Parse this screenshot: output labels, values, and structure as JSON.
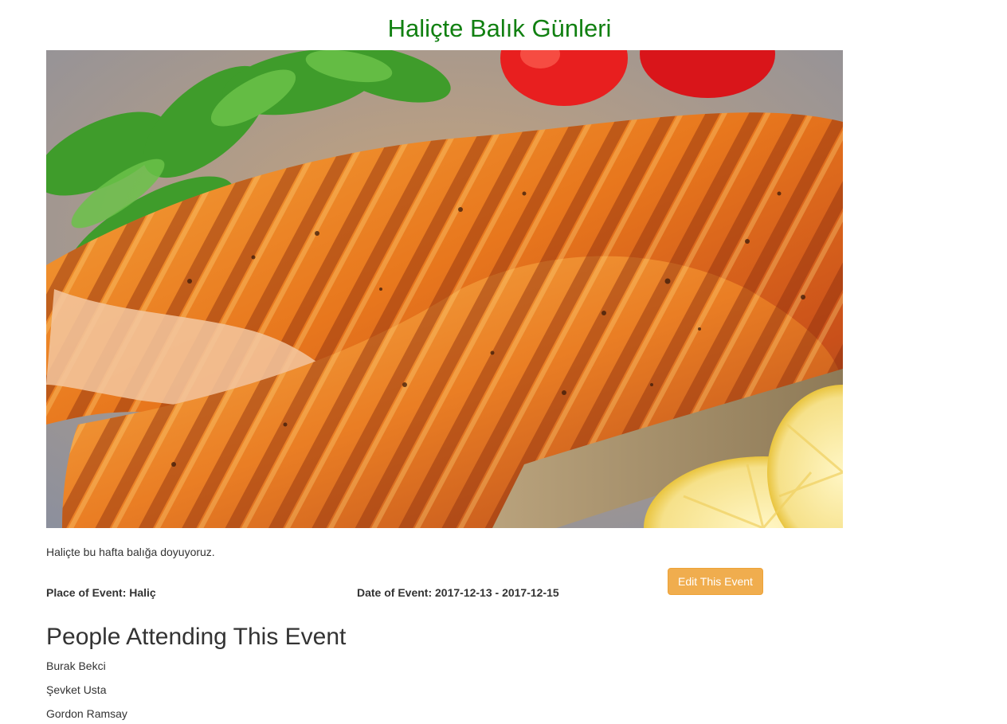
{
  "event": {
    "title": "Haliçte Balık Günleri",
    "description": "Haliçte bu hafta balığa doyuyoruz.",
    "place_text": "Place of Event: Haliç",
    "date_text": "Date of Event: 2017-12-13 - 2017-12-15",
    "edit_button_label": "Edit This Event",
    "image_alt": "grilled salmon steak with parsley and lemon"
  },
  "attending": {
    "heading": "People Attending This Event",
    "people": [
      "Burak Bekci",
      "Şevket Usta",
      "Gordon Ramsay"
    ]
  },
  "colors": {
    "title": "#118011",
    "button": "#f0ad4e",
    "text": "#333333"
  }
}
